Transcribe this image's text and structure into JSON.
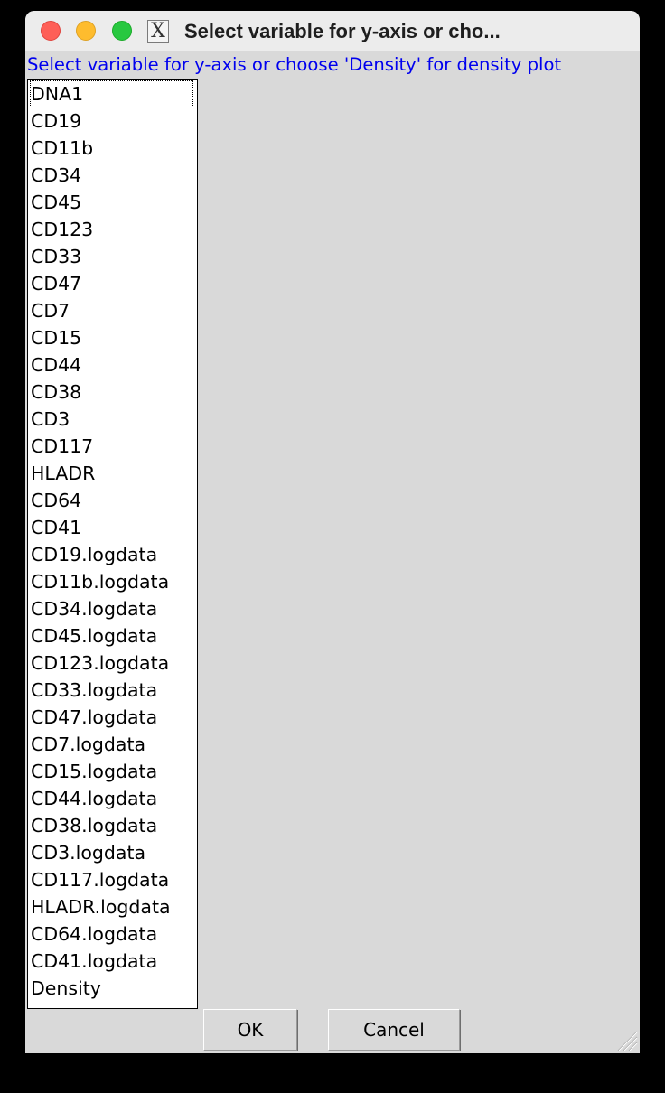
{
  "window": {
    "title": "Select variable for y-axis or cho..."
  },
  "prompt": "Select variable for y-axis or choose 'Density' for density plot",
  "variables": [
    "DNA1",
    "CD19",
    "CD11b",
    "CD34",
    "CD45",
    "CD123",
    "CD33",
    "CD47",
    "CD7",
    "CD15",
    "CD44",
    "CD38",
    "CD3",
    "CD117",
    "HLADR",
    "CD64",
    "CD41",
    "CD19.logdata",
    "CD11b.logdata",
    "CD34.logdata",
    "CD45.logdata",
    "CD123.logdata",
    "CD33.logdata",
    "CD47.logdata",
    "CD7.logdata",
    "CD15.logdata",
    "CD44.logdata",
    "CD38.logdata",
    "CD3.logdata",
    "CD117.logdata",
    "HLADR.logdata",
    "CD64.logdata",
    "CD41.logdata",
    "Density"
  ],
  "focused_index": 0,
  "buttons": {
    "ok": "OK",
    "cancel": "Cancel"
  },
  "icons": {
    "x11": "X",
    "close": "close-icon",
    "minimize": "minimize-icon",
    "zoom": "zoom-icon",
    "grip": "resize-grip-icon"
  },
  "colors": {
    "prompt": "#0000ee",
    "window_bg": "#d9d9d9",
    "list_bg": "#ffffff"
  }
}
